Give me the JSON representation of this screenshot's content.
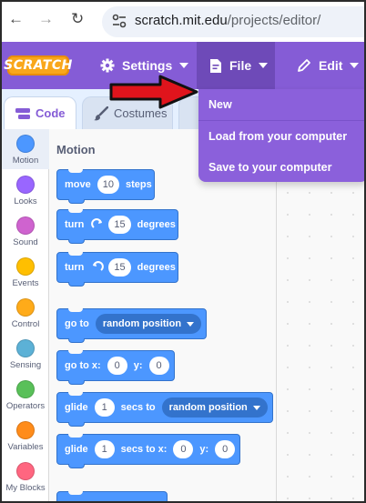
{
  "browser": {
    "url_domain": "scratch.mit.edu",
    "url_path": "/projects/editor/"
  },
  "menubar": {
    "logo_text": "SCRATCH",
    "settings_label": "Settings",
    "file_label": "File",
    "edit_label": "Edit"
  },
  "file_menu": {
    "items": [
      "New",
      "Load from your computer",
      "Save to your computer"
    ]
  },
  "tabs": {
    "code_label": "Code",
    "costumes_label": "Costumes"
  },
  "categories": [
    {
      "label": "Motion",
      "color": "#4c97ff"
    },
    {
      "label": "Looks",
      "color": "#9966ff"
    },
    {
      "label": "Sound",
      "color": "#cf63cf"
    },
    {
      "label": "Events",
      "color": "#ffbf00"
    },
    {
      "label": "Control",
      "color": "#ffab19"
    },
    {
      "label": "Sensing",
      "color": "#5cb1d6"
    },
    {
      "label": "Operators",
      "color": "#59c059"
    },
    {
      "label": "Variables",
      "color": "#ff8c1a"
    },
    {
      "label": "My Blocks",
      "color": "#ff6680"
    }
  ],
  "palette": {
    "title": "Motion",
    "blocks": {
      "move": {
        "pre": "move",
        "value": "10",
        "post": "steps"
      },
      "turn_right": {
        "pre": "turn",
        "value": "15",
        "post": "degrees"
      },
      "turn_left": {
        "pre": "turn",
        "value": "15",
        "post": "degrees"
      },
      "goto": {
        "pre": "go to",
        "menu": "random position"
      },
      "goto_xy": {
        "pre": "go to x:",
        "x": "0",
        "ylabel": "y:",
        "y": "0"
      },
      "glide_to": {
        "pre": "glide",
        "secs": "1",
        "mid": "secs to",
        "menu": "random position"
      },
      "glide_xy": {
        "pre": "glide",
        "secs": "1",
        "mid": "secs to x:",
        "x": "0",
        "ylabel": "y:",
        "y": "0"
      }
    }
  },
  "colors": {
    "menubar": "#855cd6",
    "block": "#4c97ff",
    "annotation_arrow": "#e0141c"
  }
}
